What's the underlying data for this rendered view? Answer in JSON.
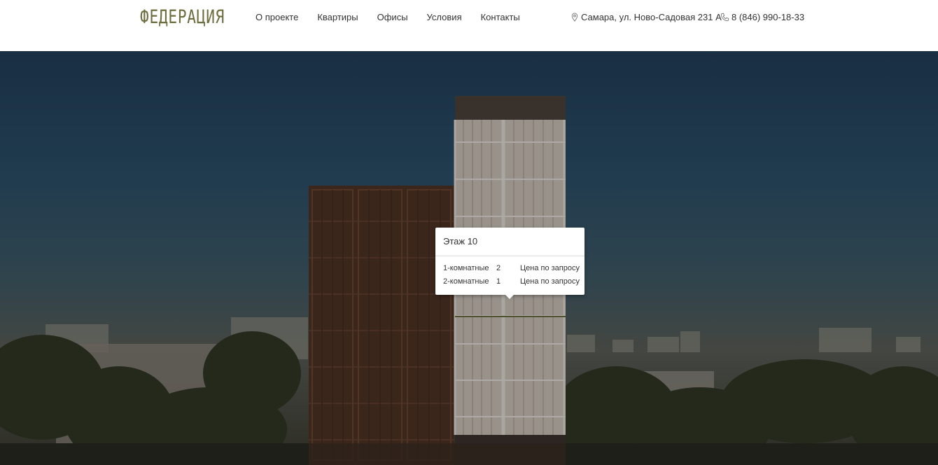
{
  "logo": "ФЕДЕРАЦИЯ",
  "nav": [
    "О проекте",
    "Квартиры",
    "Офисы",
    "Условия",
    "Контакты"
  ],
  "contacts": {
    "address": "Самара, ул. Ново-Садовая 231 А",
    "phone": "8 (846) 990-18-33"
  },
  "tooltip": {
    "title": "Этаж 10",
    "rows": [
      {
        "type": "1-комнатные",
        "count": "2",
        "price": "Цена по запросу"
      },
      {
        "type": "2-комнатные",
        "count": "1",
        "price": "Цена по запросу"
      }
    ]
  },
  "colors": {
    "logo": "#6b6d3c",
    "text": "#333333"
  }
}
